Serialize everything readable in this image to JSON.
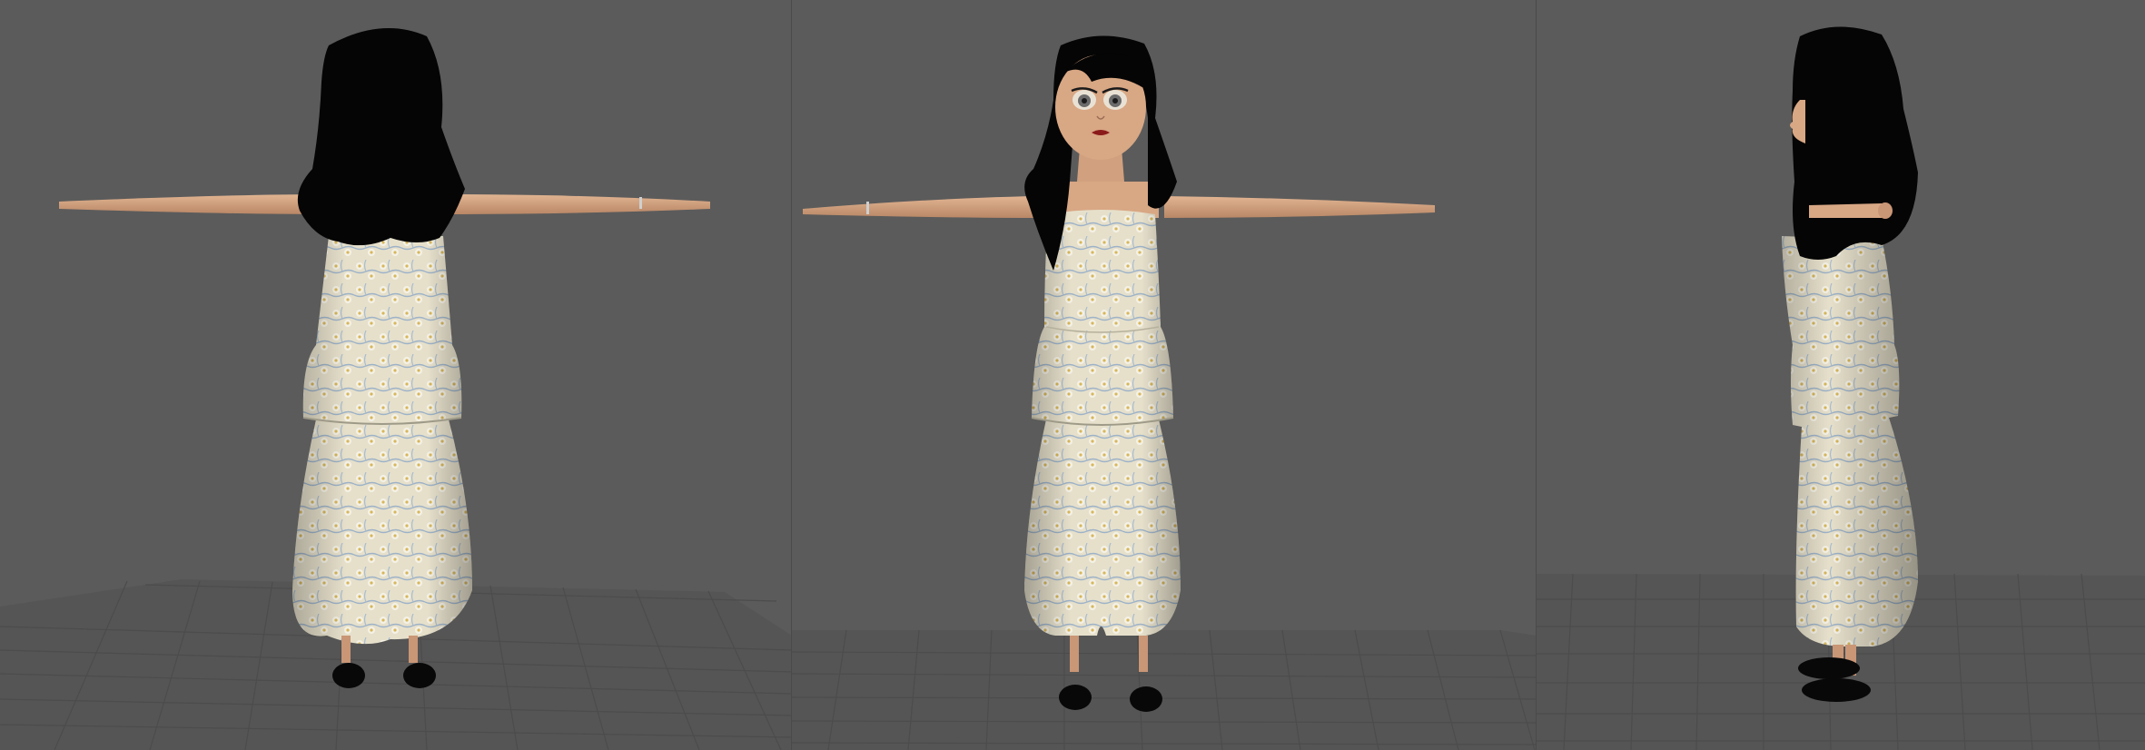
{
  "viewports": [
    {
      "name": "back-view",
      "view": "back"
    },
    {
      "name": "front-view",
      "view": "front"
    },
    {
      "name": "side-view",
      "view": "side"
    }
  ],
  "colors": {
    "background": "#5a5a5a",
    "grid_line": "#4a4a4a",
    "grid_floor": "#555555",
    "skin": "#d8a784",
    "skin_shadow": "#b98766",
    "hair": "#050505",
    "dress_base": "#e8e2cc",
    "dress_pattern_blue": "#9db2c8",
    "dress_pattern_yellow": "#d8b75a",
    "shoe": "#080808",
    "lips": "#8b1a1a"
  },
  "icons": [
    "character-model",
    "ground-grid"
  ]
}
